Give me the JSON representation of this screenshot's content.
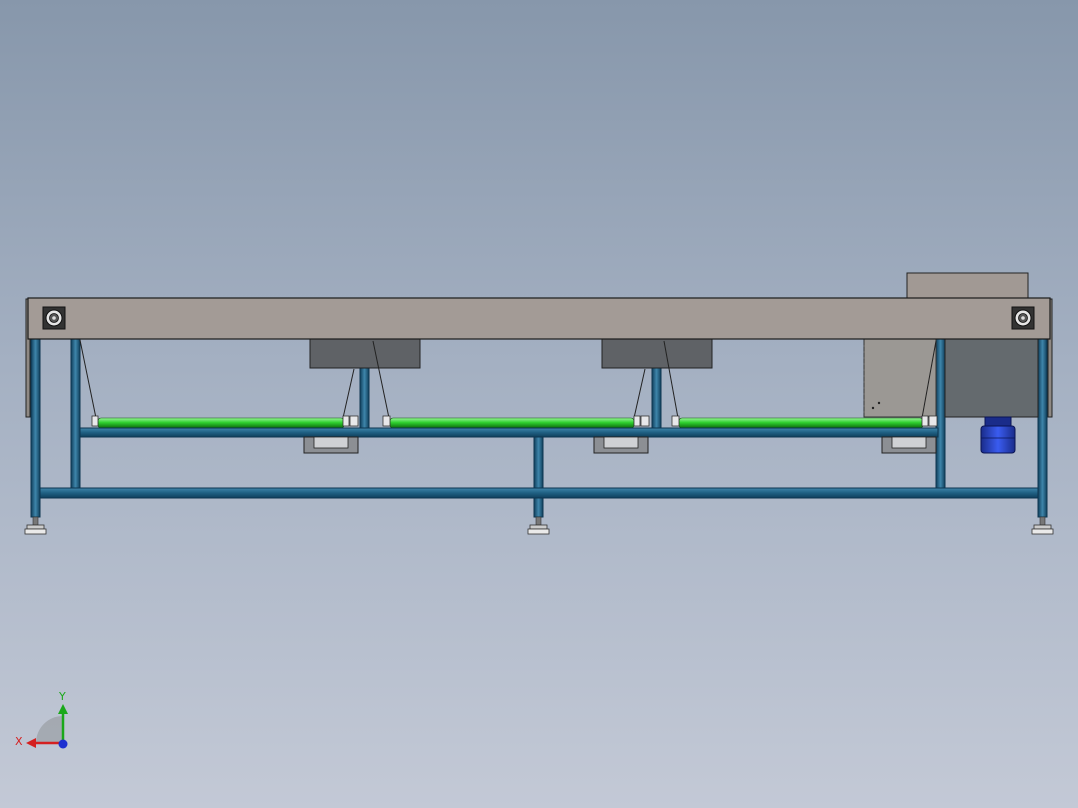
{
  "viewport": {
    "background_top": "#8797ab",
    "background_bottom": "#c3c9d6"
  },
  "model": {
    "belt_color": "#a39b96",
    "frame_color": "#1f5f82",
    "frame_edge": "#0d3550",
    "roller_color": "#2fd12f",
    "block_color": "#5f6266",
    "motor_color": "#2b47c8",
    "roller_count": 3,
    "leg_count": 3
  },
  "triad": {
    "x_label": "X",
    "y_label": "Y",
    "x_color": "#d42020",
    "y_color": "#1aa81a",
    "z_color": "#1c2fd0"
  }
}
